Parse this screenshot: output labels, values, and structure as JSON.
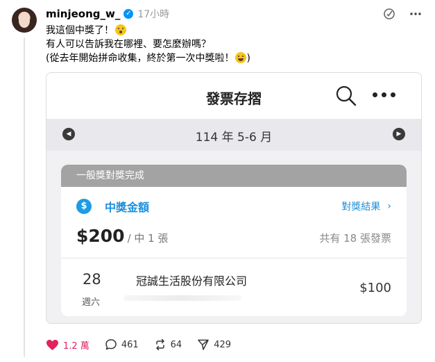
{
  "post": {
    "username": "minjeong_w_",
    "time": "17小時",
    "lines": [
      "我這個中獎了！",
      "有人可以告訴我在哪裡、要怎麼辦嗎？",
      "(從去年開始拼命收集，終於第一次中獎啦！"
    ],
    "line3_suffix": ")"
  },
  "app": {
    "title": "發票存摺",
    "period": "114 年 5-6 月",
    "result_header": "一般獎對獎完成",
    "prize_label": "中獎金額",
    "prize_link": "對獎結果",
    "prize_link_arrow": "›",
    "amount": "$200",
    "amount_sub": "/ 中 1 張",
    "total": "共有 18 張發票",
    "invoice": {
      "day": "28",
      "weekday": "週六",
      "company": "冠誠生活股份有限公司",
      "amount": "$100"
    }
  },
  "actions": {
    "likes": "1.2 萬",
    "comments": "461",
    "reposts": "64",
    "shares": "429"
  },
  "colors": {
    "accent": "#1e8fdb",
    "like": "#e0245e",
    "verified": "#0095f6"
  },
  "icons": [
    "verified-icon",
    "subscribe-icon",
    "more-icon",
    "search-icon",
    "dollar-icon",
    "heart-icon",
    "comment-icon",
    "repost-icon",
    "share-icon"
  ]
}
